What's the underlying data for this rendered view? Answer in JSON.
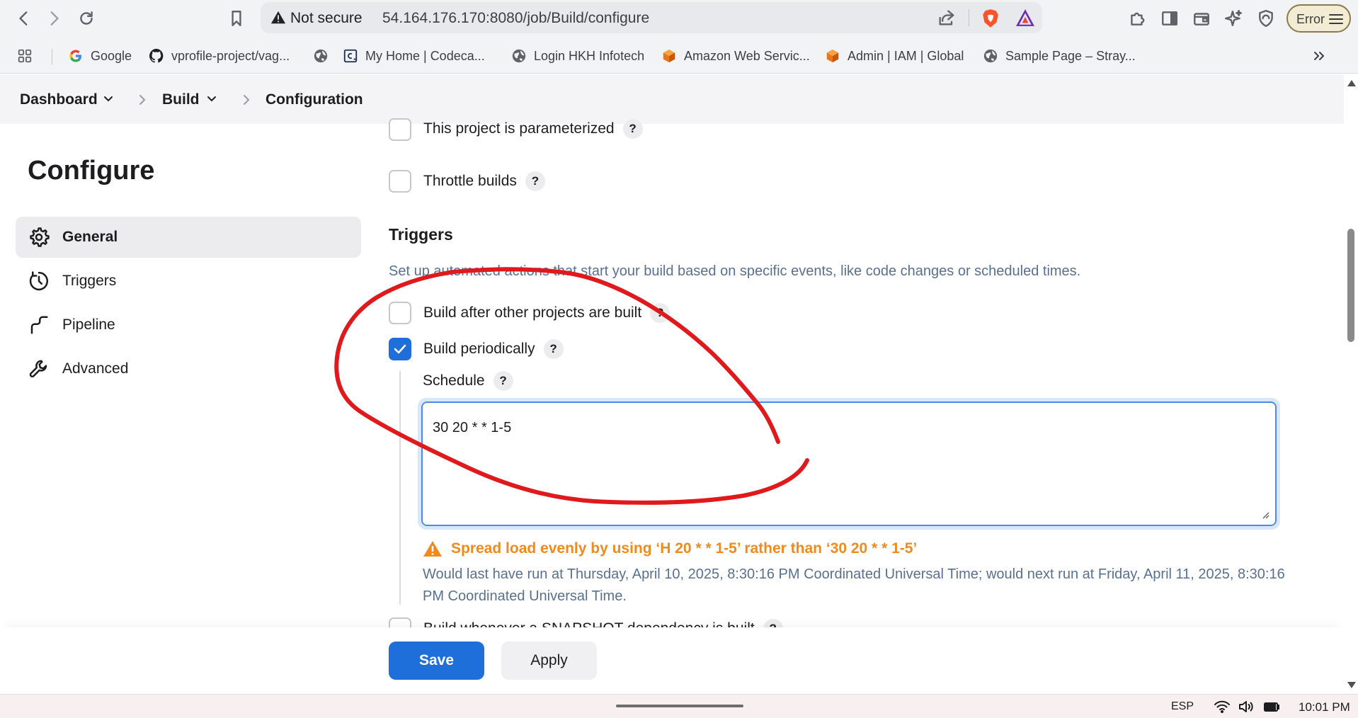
{
  "browser": {
    "security_label": "Not secure",
    "url": "54.164.176.170:8080/job/Build/configure",
    "error_label": "Error"
  },
  "bookmarks": [
    {
      "label": "Google",
      "icon": "google-icon"
    },
    {
      "label": "vprofile-project/vag...",
      "icon": "github-icon"
    },
    {
      "label": "",
      "icon": "globe-icon"
    },
    {
      "label": "My Home | Codeca...",
      "icon": "codecademy-icon"
    },
    {
      "label": "Login HKH Infotech",
      "icon": "globe-icon"
    },
    {
      "label": "Amazon Web Servic...",
      "icon": "aws-cube-icon"
    },
    {
      "label": "Admin | IAM | Global",
      "icon": "aws-cube-icon"
    },
    {
      "label": "Sample Page – Stray...",
      "icon": "globe-icon"
    }
  ],
  "breadcrumb": {
    "items": [
      "Dashboard",
      "Build",
      "Configuration"
    ]
  },
  "sidebar": {
    "title": "Configure",
    "items": [
      {
        "label": "General",
        "icon": "gear-icon",
        "active": true
      },
      {
        "label": "Triggers",
        "icon": "clock-icon",
        "active": false
      },
      {
        "label": "Pipeline",
        "icon": "pipeline-icon",
        "active": false
      },
      {
        "label": "Advanced",
        "icon": "wrench-icon",
        "active": false
      }
    ]
  },
  "general": {
    "parameterized_label": "This project is parameterized",
    "throttle_label": "Throttle builds"
  },
  "triggers": {
    "title": "Triggers",
    "description": "Set up automated actions that start your build based on specific events, like code changes or scheduled times.",
    "after_other_label": "Build after other projects are built",
    "periodically_label": "Build periodically",
    "schedule_label": "Schedule",
    "schedule_value": "30 20 * * 1-5",
    "warning": "Spread load evenly by using ‘H 20 * * 1-5’ rather than ‘30 20 * * 1-5’",
    "next_run": "Would last have run at Thursday, April 10, 2025, 8:30:16 PM Coordinated Universal Time; would next run at Friday, April 11, 2025, 8:30:16 PM Coordinated Universal Time.",
    "cut_label": "Build whenever a SNAPSHOT dependency is built"
  },
  "help_label": "?",
  "actions": {
    "save": "Save",
    "apply": "Apply"
  },
  "taskbar": {
    "lang": "ESP",
    "time": "10:01 PM"
  },
  "colors": {
    "primary": "#1e6fd9",
    "warning": "#f08a1c",
    "annotation": "#e0191c"
  }
}
